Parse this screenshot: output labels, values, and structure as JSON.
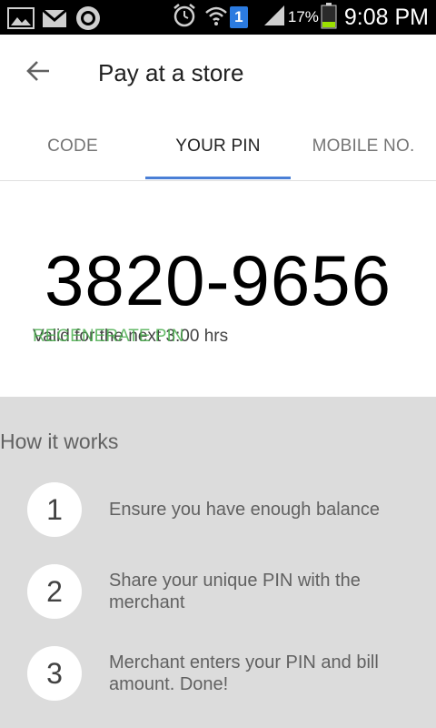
{
  "status_bar": {
    "time": "9:08 PM",
    "battery_percent": "17%",
    "sim_badge": "1",
    "icons": [
      "gallery-icon",
      "gmail-icon",
      "circle-app-icon",
      "alarm-icon",
      "wifi-icon",
      "signal-icon",
      "battery-icon"
    ]
  },
  "app_bar": {
    "title": "Pay at a store",
    "back_icon": "arrow-back-icon"
  },
  "tabs": [
    {
      "label": "CODE",
      "active": false
    },
    {
      "label": "YOUR PIN",
      "active": true
    },
    {
      "label": "MOBILE NO."
    }
  ],
  "pin": {
    "value": "3820-9656",
    "valid_text": "Valid for the next 3:00 hrs",
    "regenerate_label": "REGENERATE PIN"
  },
  "how_it_works": {
    "title": "How it works",
    "steps": [
      {
        "number": "1",
        "text": "Ensure you have enough balance"
      },
      {
        "number": "2",
        "text": "Share your unique PIN with the merchant"
      },
      {
        "number": "3",
        "text": "Merchant enters your PIN and bill amount. Done!"
      }
    ]
  },
  "colors": {
    "accent": "#4a7fd6",
    "regenerate": "#4caf50",
    "section_bg": "#dcdcdc"
  }
}
